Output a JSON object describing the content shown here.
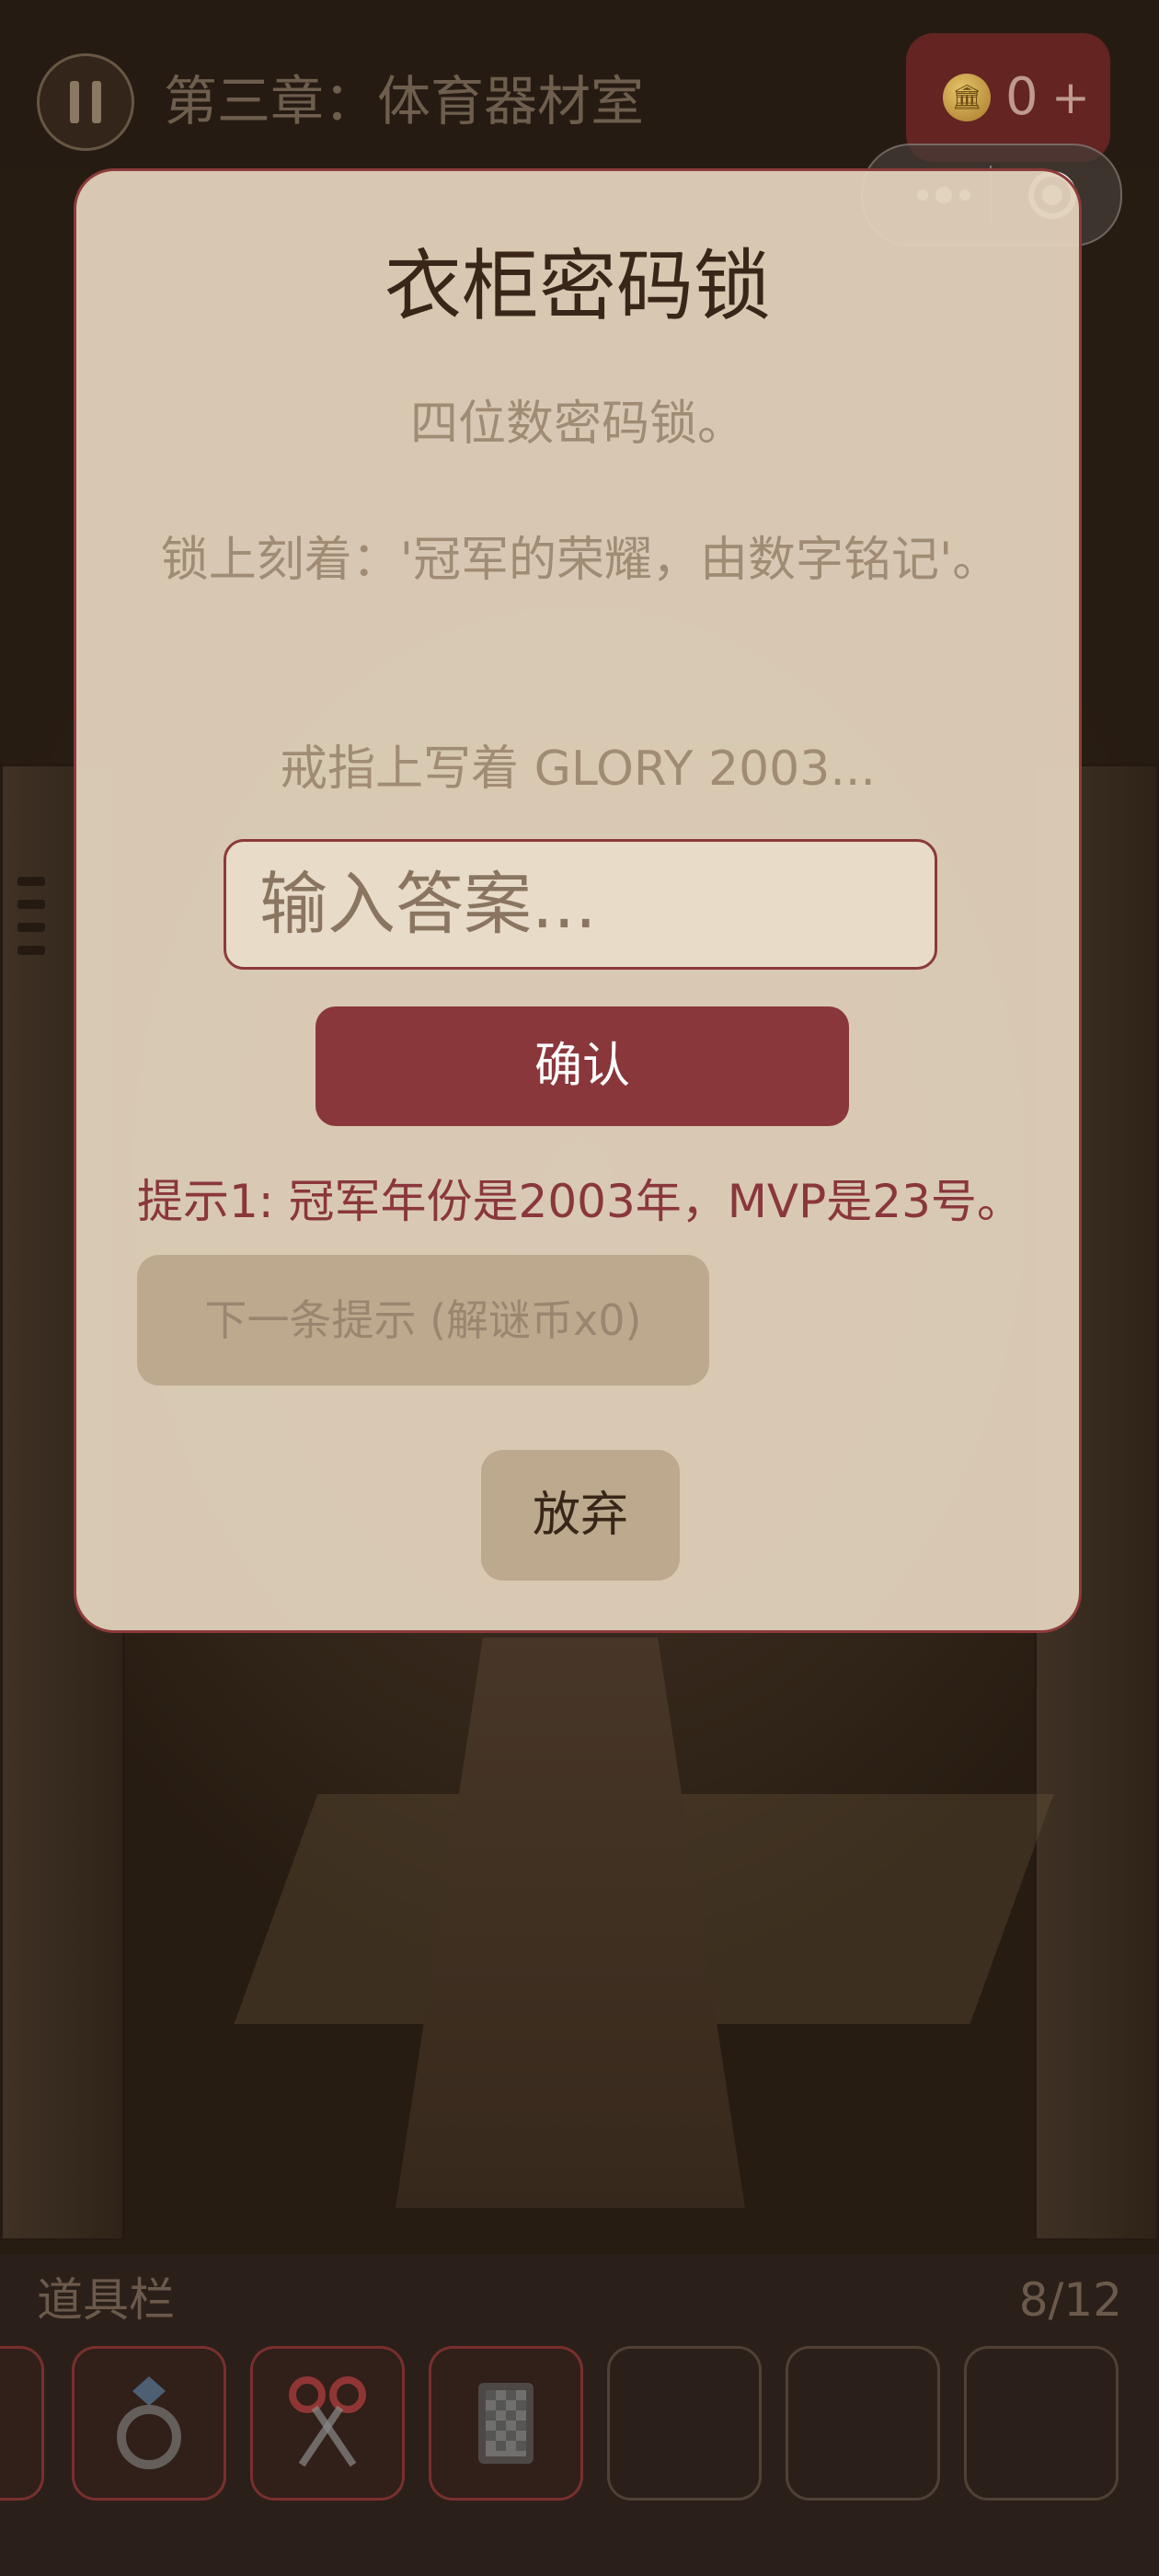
{
  "header": {
    "chapter_title": "第三章：体育器材室",
    "coins": "0",
    "coin_add": "+"
  },
  "modal": {
    "title": "衣柜密码锁",
    "subtitle": "四位数密码锁。",
    "inscription": "锁上刻着：'冠军的荣耀，由数字铭记'。",
    "clue": "戒指上写着 GLORY 2003...",
    "input_placeholder": "输入答案...",
    "confirm_label": "确认",
    "hint_text": "提示1: 冠军年份是2003年，MVP是23号。",
    "next_hint_label": "下一条提示 (解谜币x0)",
    "give_up_label": "放弃",
    "accent_color": "#8a373b"
  },
  "inventory": {
    "label": "道具栏",
    "count": "8/12",
    "items": [
      {
        "icon": "ring-icon"
      },
      {
        "icon": "scissors-icon"
      },
      {
        "icon": "book-icon"
      },
      {
        "icon": ""
      },
      {
        "icon": ""
      },
      {
        "icon": ""
      }
    ]
  }
}
